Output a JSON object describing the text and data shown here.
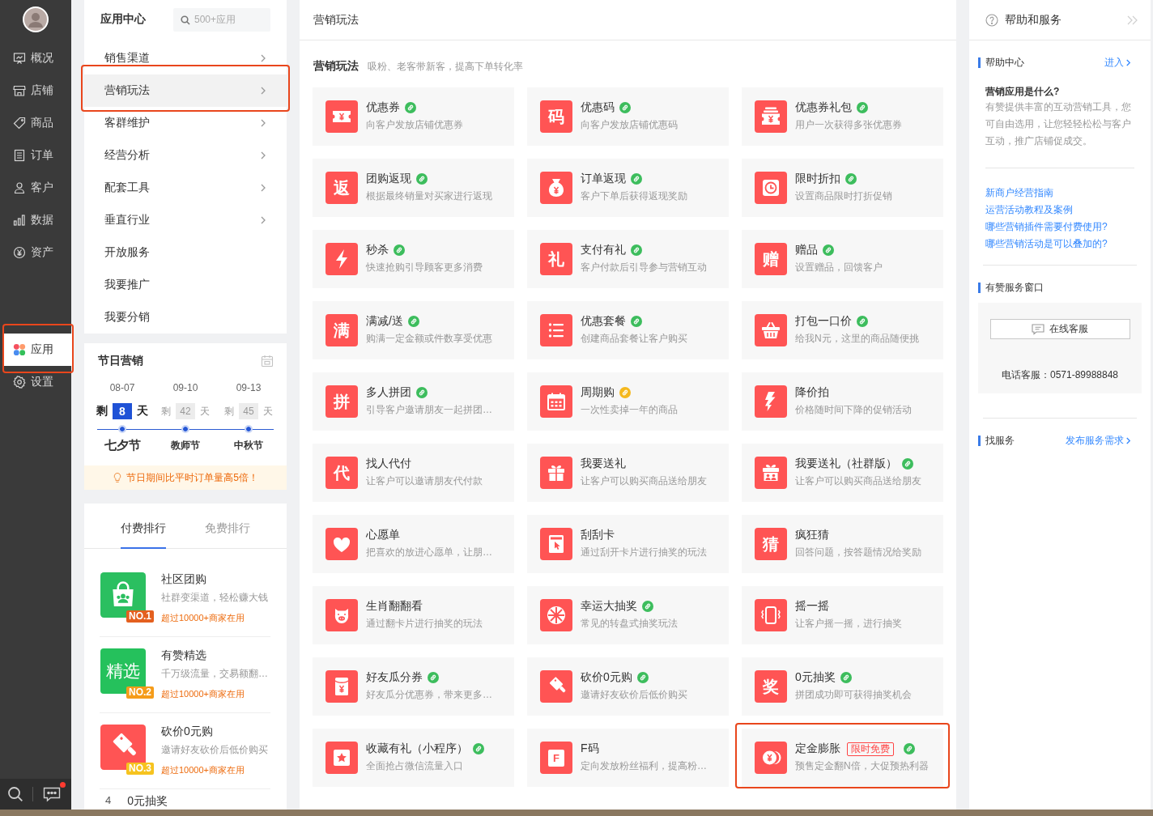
{
  "nav": {
    "groups": [
      [
        {
          "label": "概况",
          "kind": "board",
          "selected": false,
          "highlighted": false
        },
        {
          "label": "店铺",
          "kind": "shop",
          "selected": false,
          "highlighted": false
        },
        {
          "label": "商品",
          "kind": "tag",
          "selected": false,
          "highlighted": false
        },
        {
          "label": "订单",
          "kind": "list",
          "selected": false,
          "highlighted": false
        },
        {
          "label": "客户",
          "kind": "person",
          "selected": false,
          "highlighted": false
        },
        {
          "label": "数据",
          "kind": "bars",
          "selected": false,
          "highlighted": false
        },
        {
          "label": "资产",
          "kind": "yen",
          "selected": false,
          "highlighted": false
        }
      ],
      [
        {
          "label": "应用",
          "kind": "apps",
          "selected": true,
          "highlighted": true
        },
        {
          "label": "设置",
          "kind": "gear",
          "selected": false,
          "highlighted": false
        }
      ]
    ],
    "has_notification": true
  },
  "app_menu": {
    "title": "应用中心",
    "search": {
      "placeholder": "500+应用"
    },
    "items": [
      {
        "label": "销售渠道",
        "has_submenu": true,
        "selected": false,
        "highlighted": false
      },
      {
        "label": "营销玩法",
        "has_submenu": true,
        "selected": true,
        "highlighted": true
      },
      {
        "label": "客群维护",
        "has_submenu": true,
        "selected": false,
        "highlighted": false
      },
      {
        "label": "经营分析",
        "has_submenu": true,
        "selected": false,
        "highlighted": false
      },
      {
        "label": "配套工具",
        "has_submenu": true,
        "selected": false,
        "highlighted": false
      },
      {
        "label": "垂直行业",
        "has_submenu": true,
        "selected": false,
        "highlighted": false
      },
      {
        "label": "开放服务",
        "has_submenu": false,
        "selected": false,
        "highlighted": false
      },
      {
        "label": "我要推广",
        "has_submenu": false,
        "selected": false,
        "highlighted": false
      },
      {
        "label": "我要分销",
        "has_submenu": false,
        "selected": false,
        "highlighted": false
      }
    ]
  },
  "festival": {
    "title": "节日营销",
    "events": [
      {
        "date": "08-07",
        "prefix": "剩",
        "days": "8",
        "suffix": "天",
        "name": "七夕节",
        "selected": true
      },
      {
        "date": "09-10",
        "prefix": "剩",
        "days": "42",
        "suffix": "天",
        "name": "教师节",
        "selected": false
      },
      {
        "date": "09-13",
        "prefix": "剩",
        "days": "45",
        "suffix": "天",
        "name": "中秋节",
        "selected": false
      }
    ],
    "tip": "节日期间比平时订单量高5倍！"
  },
  "ranking": {
    "tabs": [
      {
        "label": "付费排行",
        "selected": true
      },
      {
        "label": "免费排行",
        "selected": false
      }
    ],
    "items": [
      {
        "kind": "bag",
        "title": "社区团购",
        "desc": "社群变渠道，轻松赚大钱",
        "users": "超过10000+商家在用",
        "rank": "NO.1",
        "color": "#e4601f"
      },
      {
        "kind": "text-tile",
        "icon_text": "精选",
        "title": "有赞精选",
        "desc": "千万级流量，交易额翻…",
        "users": "超过10000+商家在用",
        "rank": "NO.2",
        "color": "#f59c1a"
      },
      {
        "kind": "cleaver",
        "title": "砍价0元购",
        "desc": "邀请好友砍价后低价购买",
        "users": "超过10000+商家在用",
        "rank": "NO.3",
        "color": "#f6c31f"
      },
      {
        "kind": "number",
        "rank": "4",
        "title": "0元抽奖"
      }
    ]
  },
  "main": {
    "title": "营销玩法",
    "section": {
      "title": "营销玩法",
      "subtitle": "吸粉、老客带新客，提高下单转化率"
    },
    "cards": [
      {
        "title": "优惠券",
        "desc": "向客户发放店铺优惠券",
        "kind": "ticket",
        "badge": {
          "color": "#3dbd5d"
        },
        "highlighted": false
      },
      {
        "title": "优惠码",
        "desc": "向客户发放店铺优惠码",
        "kind": "text",
        "icon_text": "码",
        "badge": {
          "color": "#3dbd5d"
        },
        "highlighted": false
      },
      {
        "title": "优惠券礼包",
        "desc": "用户一次获得多张优惠券",
        "kind": "coupons",
        "badge": {
          "color": "#3dbd5d"
        },
        "highlighted": false
      },
      {
        "title": "团购返现",
        "desc": "根据最终销量对买家进行返现",
        "kind": "text",
        "icon_text": "返",
        "badge": {
          "color": "#3dbd5d"
        },
        "highlighted": false
      },
      {
        "title": "订单返现",
        "desc": "客户下单后获得返现奖励",
        "kind": "money-bag",
        "badge": {
          "color": "#3dbd5d"
        },
        "highlighted": false
      },
      {
        "title": "限时折扣",
        "desc": "设置商品限时打折促销",
        "kind": "clock",
        "badge": {
          "color": "#3dbd5d"
        },
        "highlighted": false
      },
      {
        "title": "秒杀",
        "desc": "快速抢购引导顾客更多消费",
        "kind": "bolt",
        "badge": {
          "color": "#3dbd5d"
        },
        "highlighted": false
      },
      {
        "title": "支付有礼",
        "desc": "客户付款后引导参与营销互动",
        "kind": "text",
        "icon_text": "礼",
        "badge": {
          "color": "#3dbd5d"
        },
        "highlighted": false
      },
      {
        "title": "赠品",
        "desc": "设置赠品，回馈客户",
        "kind": "text",
        "icon_text": "赠",
        "badge": {
          "color": "#3dbd5d"
        },
        "highlighted": false
      },
      {
        "title": "满减/送",
        "desc": "购满一定金额或件数享受优惠",
        "kind": "text",
        "icon_text": "满",
        "badge": {
          "color": "#3dbd5d"
        },
        "highlighted": false
      },
      {
        "title": "优惠套餐",
        "desc": "创建商品套餐让客户购买",
        "kind": "list",
        "badge": {
          "color": "#3dbd5d"
        },
        "highlighted": false
      },
      {
        "title": "打包一口价",
        "desc": "给我N元，这里的商品随便挑",
        "kind": "basket",
        "badge": {
          "color": "#3dbd5d"
        },
        "highlighted": false
      },
      {
        "title": "多人拼团",
        "desc": "引导客户邀请朋友一起拼团…",
        "kind": "text",
        "icon_text": "拼",
        "badge": {
          "color": "#3dbd5d"
        },
        "highlighted": false
      },
      {
        "title": "周期购",
        "desc": "一次性卖掉一年的商品",
        "kind": "calendar",
        "badge": {
          "color": "#f5b81d"
        },
        "highlighted": false
      },
      {
        "title": "降价拍",
        "desc": "价格随时间下降的促销活动",
        "kind": "price-drop",
        "highlighted": false
      },
      {
        "title": "找人代付",
        "desc": "让客户可以邀请朋友代付款",
        "kind": "text",
        "icon_text": "代",
        "highlighted": false
      },
      {
        "title": "我要送礼",
        "desc": "让客户可以购买商品送给朋友",
        "kind": "gift",
        "highlighted": false
      },
      {
        "title": "我要送礼（社群版）",
        "desc": "让客户可以购买商品送给朋友",
        "kind": "gift-group",
        "badge": {
          "color": "#3dbd5d"
        },
        "highlighted": false
      },
      {
        "title": "心愿单",
        "desc": "把喜欢的放进心愿单，让朋…",
        "kind": "heart",
        "highlighted": false
      },
      {
        "title": "刮刮卡",
        "desc": "通过刮开卡片进行抽奖的玩法",
        "kind": "scratch",
        "highlighted": false
      },
      {
        "title": "疯狂猜",
        "desc": "回答问题，按答题情况给奖励",
        "kind": "text",
        "icon_text": "猜",
        "highlighted": false
      },
      {
        "title": "生肖翻翻看",
        "desc": "通过翻卡片进行抽奖的玩法",
        "kind": "pig",
        "highlighted": false
      },
      {
        "title": "幸运大抽奖",
        "desc": "常见的转盘式抽奖玩法",
        "kind": "wheel",
        "badge": {
          "color": "#3dbd5d"
        },
        "highlighted": false
      },
      {
        "title": "摇一摇",
        "desc": "让客户摇一摇，进行抽奖",
        "kind": "phone-shake",
        "highlighted": false
      },
      {
        "title": "好友瓜分券",
        "desc": "好友瓜分优惠券，带来更多…",
        "kind": "envelope",
        "badge": {
          "color": "#3dbd5d"
        },
        "highlighted": false
      },
      {
        "title": "砍价0元购",
        "desc": "邀请好友砍价后低价购买",
        "kind": "cleaver",
        "badge": {
          "color": "#3dbd5d"
        },
        "highlighted": false
      },
      {
        "title": "0元抽奖",
        "desc": "拼团成功即可获得抽奖机会",
        "kind": "text",
        "icon_text": "奖",
        "badge": {
          "color": "#3dbd5d"
        },
        "highlighted": false
      },
      {
        "title": "收藏有礼（小程序）",
        "desc": "全面抢占微信流量入口",
        "kind": "star",
        "badge": {
          "color": "#3dbd5d"
        },
        "highlighted": false
      },
      {
        "title": "F码",
        "desc": "定向发放粉丝福利，提高粉…",
        "kind": "letter-card",
        "icon_text": "F",
        "highlighted": false
      },
      {
        "title": "定金膨胀",
        "desc": "预售定金翻N倍，大促预热利器",
        "kind": "coins",
        "tag": "限时免费",
        "badge": {
          "color": "#3dbd5d"
        },
        "highlighted": true
      }
    ]
  },
  "help": {
    "title": "帮助和服务",
    "center": {
      "title": "帮助中心",
      "link": "进入",
      "question": "营销应用是什么?",
      "answer": "有赞提供丰富的互动营销工具，您可自由选用，让您轻轻松松与客户互动，推广店铺促成交。",
      "links": [
        "新商户经营指南",
        "运营活动教程及案例",
        "哪些营销插件需要付费使用?",
        "哪些营销活动是可以叠加的?"
      ]
    },
    "service": {
      "title": "有赞服务窗口",
      "button": "在线客服",
      "phone": "电话客服：0571-89988848"
    },
    "find": {
      "title": "找服务",
      "link": "发布服务需求"
    }
  }
}
